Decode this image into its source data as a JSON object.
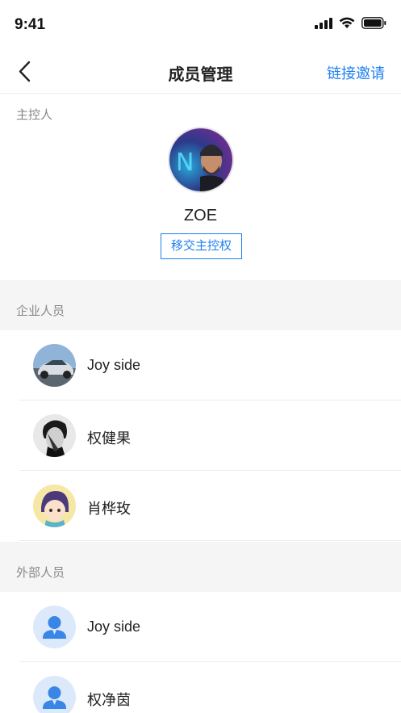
{
  "status_bar": {
    "time": "9:41"
  },
  "nav": {
    "title": "成员管理",
    "action_label": "链接邀请",
    "back_icon": "chevron-left-icon"
  },
  "host": {
    "section_label": "主控人",
    "name": "ZOE",
    "transfer_label": "移交主控权"
  },
  "enterprise": {
    "section_label": "企业人员",
    "members": [
      {
        "name": "Joy side"
      },
      {
        "name": "权健果"
      },
      {
        "name": "肖桦玫"
      }
    ]
  },
  "external": {
    "section_label": "外部人员",
    "members": [
      {
        "name": "Joy side"
      },
      {
        "name": "权净茵"
      }
    ]
  },
  "colors": {
    "accent": "#1f7ff0",
    "section_bg": "#f5f5f5",
    "placeholder_avatar_bg": "#dbe9fb",
    "placeholder_avatar_fg": "#3a86e6"
  }
}
